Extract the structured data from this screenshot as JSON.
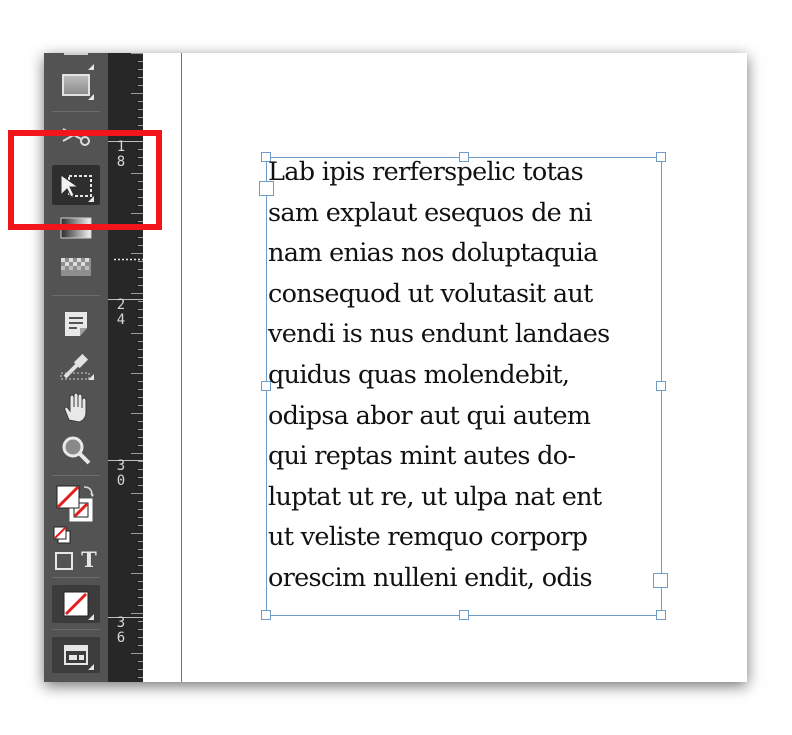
{
  "toolbar": {
    "tools": [
      {
        "name": "rectangle-tool",
        "icon": "rectangle-icon",
        "selected": false,
        "has_submenu": true
      },
      {
        "name": "scissors-tool",
        "icon": "scissors-icon",
        "selected": false,
        "has_submenu": false
      },
      {
        "name": "free-transform-tool",
        "icon": "free-transform-icon",
        "selected": true,
        "has_submenu": true
      },
      {
        "name": "gradient-swatch-tool",
        "icon": "gradient-swatch-icon",
        "selected": false,
        "has_submenu": false
      },
      {
        "name": "gradient-feather-tool",
        "icon": "gradient-feather-icon",
        "selected": false,
        "has_submenu": false
      },
      {
        "name": "note-tool",
        "icon": "note-icon",
        "selected": false,
        "has_submenu": false
      },
      {
        "name": "eyedropper-tool",
        "icon": "eyedropper-icon",
        "selected": false,
        "has_submenu": true
      },
      {
        "name": "hand-tool",
        "icon": "hand-icon",
        "selected": false,
        "has_submenu": false
      },
      {
        "name": "zoom-tool",
        "icon": "zoom-icon",
        "selected": false,
        "has_submenu": false
      }
    ],
    "formatting_text_glyph": "T",
    "colors": {
      "panel": "#535353",
      "ruler": "#272727",
      "highlight": "#f2151a",
      "frame": "#6d9cc9",
      "margin_guide": "#b343b8"
    }
  },
  "ruler": {
    "labels": [
      {
        "digits": [
          "1",
          "8"
        ]
      },
      {
        "digits": [
          "2",
          "4"
        ]
      },
      {
        "digits": [
          "3",
          "0"
        ]
      },
      {
        "digits": [
          "3",
          "6"
        ]
      }
    ]
  },
  "story": {
    "lines": [
      "Lab ipis rerferspelic totas",
      "sam explaut esequos de ni",
      "nam enias nos doluptaquia",
      "consequod ut volutasit aut",
      "vendi is nus endunt landaes",
      "quidus quas molendebit,",
      "odipsa abor aut qui autem",
      "qui reptas mint autes do-",
      "luptat ut re, ut ulpa nat ent",
      "ut veliste remquo corporp",
      "orescim nulleni endit, odis"
    ]
  }
}
